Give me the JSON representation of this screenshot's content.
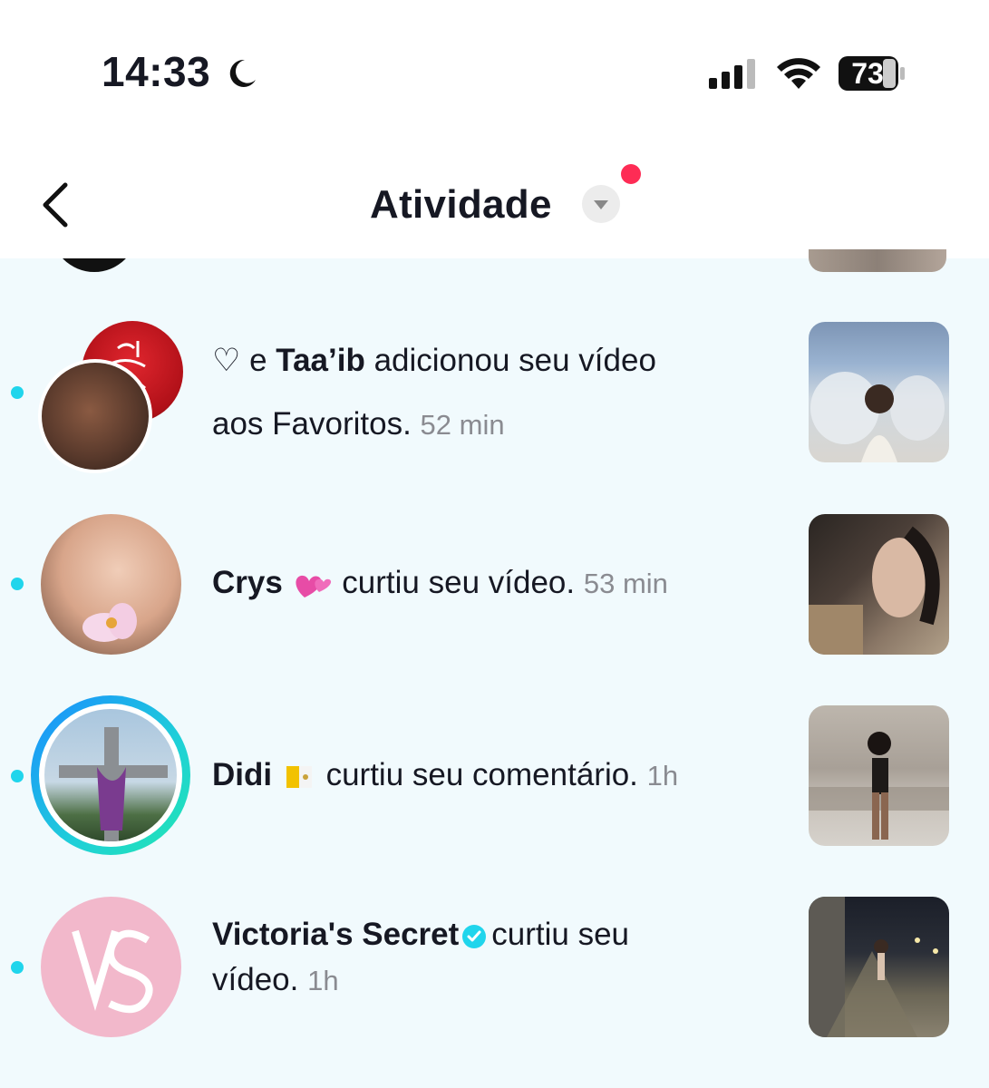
{
  "status_bar": {
    "time": "14:33",
    "battery": "73"
  },
  "header": {
    "title": "Atividade"
  },
  "notifications": [
    {
      "prefix": "♡ e ",
      "name": "Taa’ib",
      "action": " adicionou seu vídeo",
      "action2": "aos Favoritos.",
      "time": "52 min"
    },
    {
      "name": "Crys",
      "action": "curtiu seu vídeo.",
      "time": "53 min"
    },
    {
      "name": "Didi",
      "action": "curtiu seu comentário.",
      "time": "1h"
    },
    {
      "name": "Victoria's Secret",
      "action": "curtiu seu",
      "action2": "vídeo.",
      "time": "1h"
    }
  ],
  "colors": {
    "unread_dot": "#20d5ec",
    "notification_dot": "#fe2c55",
    "verified": "#20d5ec"
  }
}
